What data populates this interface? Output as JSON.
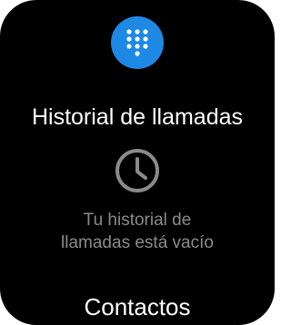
{
  "colors": {
    "background": "#000000",
    "accent": "#1e88e5",
    "text_primary": "#ffffff",
    "text_secondary": "#8a8a8a",
    "icon_muted": "#8a8a8a"
  },
  "header": {
    "dialpad_icon": "dialpad-icon"
  },
  "main": {
    "title": "Historial de llamadas",
    "empty_icon": "clock-icon",
    "empty_message_line1": "Tu historial de",
    "empty_message_line2": "llamadas está vacío"
  },
  "footer": {
    "contacts_label": "Contactos"
  }
}
